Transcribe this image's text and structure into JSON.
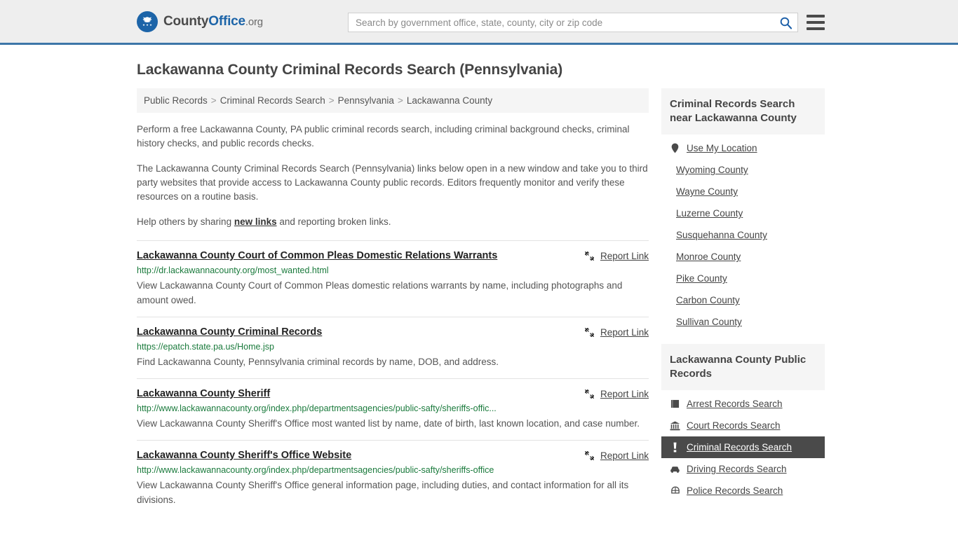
{
  "header": {
    "logo": {
      "part1": "County",
      "part2": "Office",
      "part3": ".org",
      "icon": "eagle-seal-icon"
    },
    "search": {
      "placeholder": "Search by government office, state, county, city or zip code",
      "value": "",
      "search_icon": "search-icon"
    },
    "menu_icon": "hamburger-menu-icon",
    "accent_color": "#3d76a8",
    "background": "#eeeeee"
  },
  "main": {
    "title": "Lackawanna County Criminal Records Search (Pennsylvania)",
    "breadcrumb": [
      "Public Records",
      "Criminal Records Search",
      "Pennsylvania",
      "Lackawanna County"
    ],
    "breadcrumb_separator": ">",
    "intro": {
      "p1": "Perform a free Lackawanna County, PA public criminal records search, including criminal background checks, criminal history checks, and public records checks.",
      "p2": "The Lackawanna County Criminal Records Search (Pennsylvania) links below open in a new window and take you to third party websites that provide access to Lackawanna County public records. Editors frequently monitor and verify these resources on a routine basis.",
      "p3_before": "Help others by sharing ",
      "p3_link": "new links",
      "p3_after": " and reporting broken links."
    },
    "report_link_label": "Report Link",
    "report_link_icon": "broken-link-icon",
    "results": [
      {
        "title": "Lackawanna County Court of Common Pleas Domestic Relations Warrants",
        "url": "http://dr.lackawannacounty.org/most_wanted.html",
        "description": "View Lackawanna County Court of Common Pleas domestic relations warrants by name, including photographs and amount owed."
      },
      {
        "title": "Lackawanna County Criminal Records",
        "url": "https://epatch.state.pa.us/Home.jsp",
        "description": "Find Lackawanna County, Pennsylvania criminal records by name, DOB, and address."
      },
      {
        "title": "Lackawanna County Sheriff",
        "url": "http://www.lackawannacounty.org/index.php/departmentsagencies/public-safty/sheriffs-offic...",
        "description": "View Lackawanna County Sheriff's Office most wanted list by name, date of birth, last known location, and case number."
      },
      {
        "title": "Lackawanna County Sheriff's Office Website",
        "url": "http://www.lackawannacounty.org/index.php/departmentsagencies/public-safty/sheriffs-office",
        "description": "View Lackawanna County Sheriff's Office general information page, including duties, and contact information for all its divisions."
      }
    ]
  },
  "sidebar": {
    "nearby": {
      "heading": "Criminal Records Search near Lackawanna County",
      "items": [
        {
          "label": "Use My Location",
          "icon": "map-pin-icon",
          "active": false
        },
        {
          "label": "Wyoming County",
          "icon": "",
          "active": false
        },
        {
          "label": "Wayne County",
          "icon": "",
          "active": false
        },
        {
          "label": "Luzerne County",
          "icon": "",
          "active": false
        },
        {
          "label": "Susquehanna County",
          "icon": "",
          "active": false
        },
        {
          "label": "Monroe County",
          "icon": "",
          "active": false
        },
        {
          "label": "Pike County",
          "icon": "",
          "active": false
        },
        {
          "label": "Carbon County",
          "icon": "",
          "active": false
        },
        {
          "label": "Sullivan County",
          "icon": "",
          "active": false
        }
      ]
    },
    "public_records": {
      "heading": "Lackawanna County Public Records",
      "items": [
        {
          "label": "Arrest Records Search",
          "icon": "book-icon",
          "active": false
        },
        {
          "label": "Court Records Search",
          "icon": "courthouse-icon",
          "active": false
        },
        {
          "label": "Criminal Records Search",
          "icon": "exclamation-icon",
          "active": true
        },
        {
          "label": "Driving Records Search",
          "icon": "car-icon",
          "active": false
        },
        {
          "label": "Police Records Search",
          "icon": "police-badge-icon",
          "active": false
        }
      ],
      "active_background": "#4a4a4a"
    }
  }
}
